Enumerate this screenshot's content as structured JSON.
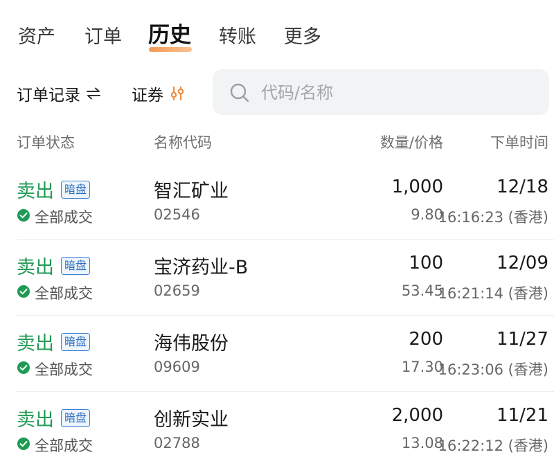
{
  "tabs": [
    {
      "label": "资产"
    },
    {
      "label": "订单"
    },
    {
      "label": "历史"
    },
    {
      "label": "转账"
    },
    {
      "label": "更多"
    }
  ],
  "active_tab": "历史",
  "toolbar": {
    "order_records_label": "订单记录",
    "securities_label": "证券",
    "search_placeholder": "代码/名称"
  },
  "table": {
    "headers": {
      "status": "订单状态",
      "name_code": "名称代码",
      "qty_price": "数量/价格",
      "order_time": "下单时间"
    },
    "rows": [
      {
        "side": "卖出",
        "tag": "暗盘",
        "status": "全部成交",
        "name": "智汇矿业",
        "code": "02546",
        "quantity": "1,000",
        "price": "9.80",
        "date": "12/18",
        "time": "16:16:23 (香港)"
      },
      {
        "side": "卖出",
        "tag": "暗盘",
        "status": "全部成交",
        "name": "宝济药业-B",
        "code": "02659",
        "quantity": "100",
        "price": "53.45",
        "date": "12/09",
        "time": "16:21:14 (香港)"
      },
      {
        "side": "卖出",
        "tag": "暗盘",
        "status": "全部成交",
        "name": "海伟股份",
        "code": "09609",
        "quantity": "200",
        "price": "17.30",
        "date": "11/27",
        "time": "16:23:06 (香港)"
      },
      {
        "side": "卖出",
        "tag": "暗盘",
        "status": "全部成交",
        "name": "创新实业",
        "code": "02788",
        "quantity": "2,000",
        "price": "13.08",
        "date": "11/21",
        "time": "16:22:12 (香港)"
      }
    ]
  },
  "colors": {
    "sell": "#1f9a55",
    "accent_orange": "#f08a3c",
    "tag_blue": "#3b7fd1"
  }
}
